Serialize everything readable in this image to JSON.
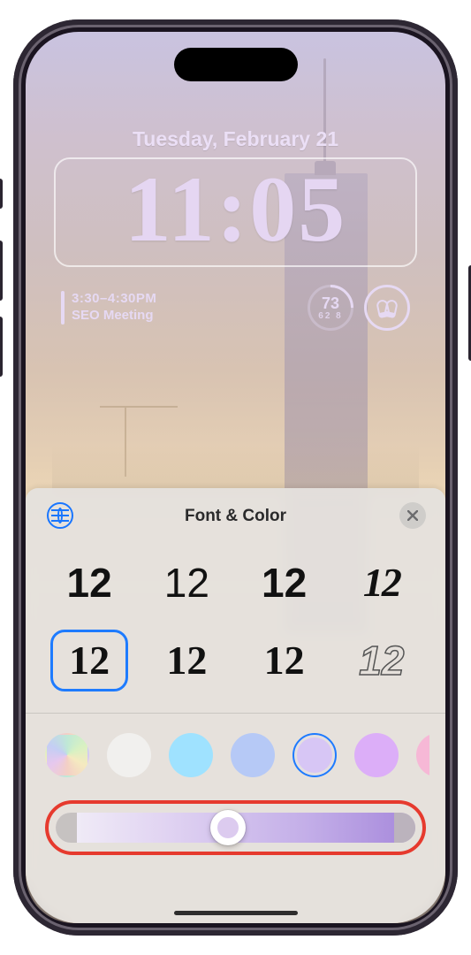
{
  "lockscreen": {
    "date": "Tuesday, February 21",
    "time": "11:05",
    "calendar": {
      "time": "3:30–4:30PM",
      "title": "SEO Meeting"
    },
    "weather": {
      "temp": "73",
      "low": "62",
      "high": "8"
    }
  },
  "sheet": {
    "title": "Font & Color",
    "font_sample": "12",
    "fonts": [
      {
        "id": "sans-bold",
        "css": "f-sans-bold",
        "selected": false
      },
      {
        "id": "sans-light",
        "css": "f-sans-light",
        "selected": false
      },
      {
        "id": "rounded",
        "css": "f-rounded",
        "selected": false
      },
      {
        "id": "stencil",
        "css": "f-stencil",
        "selected": false
      },
      {
        "id": "serif-black",
        "css": "f-serif-black",
        "selected": true
      },
      {
        "id": "slab-bold",
        "css": "f-slab-bold",
        "selected": false
      },
      {
        "id": "serif-reg",
        "css": "f-serif-reg",
        "selected": false
      },
      {
        "id": "outline",
        "css": "f-outline",
        "selected": false
      }
    ],
    "colors": [
      {
        "id": "spectrum",
        "hex": "gradient",
        "selected": false
      },
      {
        "id": "white",
        "hex": "#f1f0ee",
        "selected": false
      },
      {
        "id": "sky",
        "hex": "#9fe2ff",
        "selected": false
      },
      {
        "id": "peri",
        "hex": "#b6c9f6",
        "selected": false
      },
      {
        "id": "lilac",
        "hex": "#d7c6f5",
        "selected": true
      },
      {
        "id": "violet",
        "hex": "#dcaef8",
        "selected": false
      },
      {
        "id": "pink",
        "hex": "#f6b8d6",
        "selected": false
      }
    ],
    "slider": {
      "value_pct": 48,
      "visible_window": {
        "start_pct": 6,
        "end_pct": 94
      }
    }
  },
  "annotation": {
    "highlight_slider": true,
    "highlight_color": "#e63a2e"
  }
}
